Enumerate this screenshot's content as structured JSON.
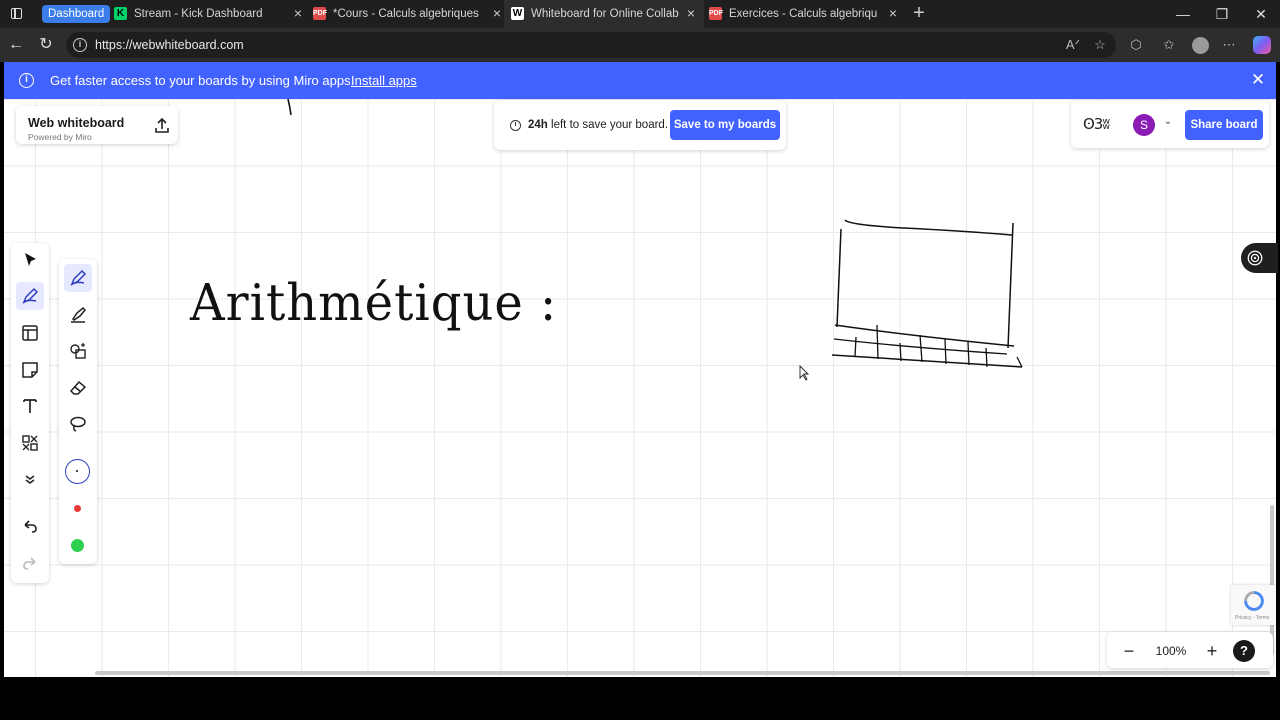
{
  "browser": {
    "group_label": "Dashboard",
    "tabs": [
      {
        "title": "Stream - Kick Dashboard",
        "favicon": "kick-icon"
      },
      {
        "title": "*Cours - Calculs algebriques dans",
        "favicon": "pdf-icon"
      },
      {
        "title": "Whiteboard for Online Collaborat",
        "favicon": "word-icon"
      },
      {
        "title": "Exercices - Calculs algebriques da",
        "favicon": "pdf-icon"
      }
    ],
    "url": "https://webwhiteboard.com"
  },
  "banner": {
    "text": "Get faster access to your boards by using Miro apps.",
    "link": "Install apps"
  },
  "brand": {
    "title": "Web whiteboard",
    "subtitle": "Powered by Miro"
  },
  "save_bar": {
    "hours": "24h",
    "text": "left to save your board.",
    "button": "Save to my boards"
  },
  "collab": {
    "reactions": "ʘ3ʬ",
    "user_initial": "S",
    "share_label": "Share board"
  },
  "board": {
    "handwriting": "Arithmétique :"
  },
  "tools": [
    "select-tool",
    "pen-tool",
    "frame-tool",
    "sticky-note-tool",
    "text-tool",
    "more-apps-tool",
    "expand-tool",
    "undo",
    "redo"
  ],
  "pen_options": {
    "colors": [
      "#ffffff",
      "#e53935",
      "#2fcf4f"
    ]
  },
  "zoom": {
    "level": "100%"
  },
  "recaptcha": {
    "text": "Privacy - Terms"
  }
}
